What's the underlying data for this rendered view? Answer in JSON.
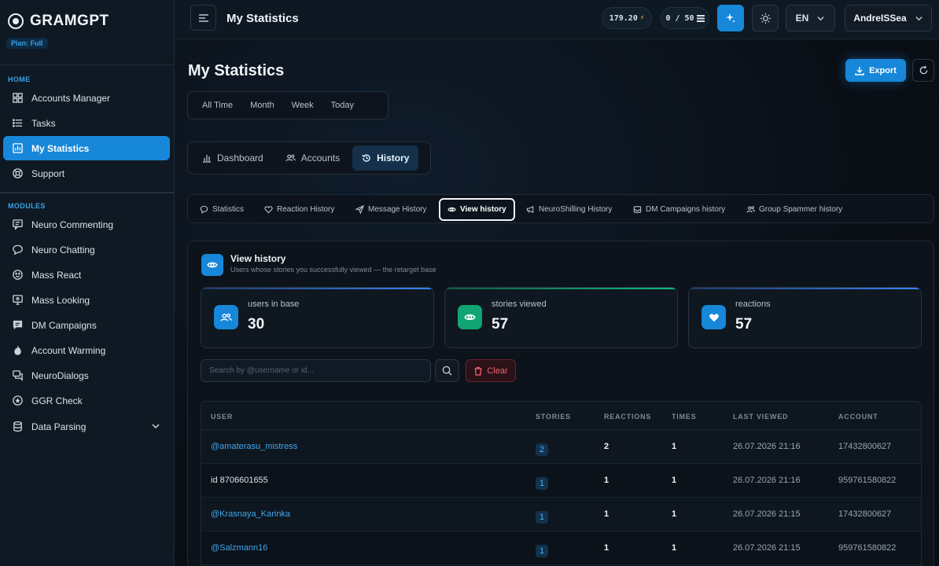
{
  "sidebar": {
    "brand": "GRAMGPT",
    "plan": "Plan: Full",
    "sections": {
      "home": "HOME",
      "modules": "MODULES"
    },
    "home_items": [
      {
        "label": "Accounts Manager",
        "icon": "grid-icon"
      },
      {
        "label": "Tasks",
        "icon": "list-icon"
      },
      {
        "label": "My Statistics",
        "icon": "chart-icon",
        "active": true
      },
      {
        "label": "Support",
        "icon": "lifebuoy-icon"
      }
    ],
    "module_items": [
      {
        "label": "Neuro Commenting",
        "icon": "comments-icon"
      },
      {
        "label": "Neuro Chatting",
        "icon": "chat-bubble-icon"
      },
      {
        "label": "Mass React",
        "icon": "smile-icon"
      },
      {
        "label": "Mass Looking",
        "icon": "monitor-eye-icon"
      },
      {
        "label": "DM Campaigns",
        "icon": "dm-icon"
      },
      {
        "label": "Account Warming",
        "icon": "flame-icon"
      },
      {
        "label": "NeuroDialogs",
        "icon": "dialogs-icon"
      },
      {
        "label": "GGR Check",
        "icon": "star-circle-icon"
      },
      {
        "label": "Data Parsing",
        "icon": "database-icon"
      }
    ]
  },
  "topbar": {
    "title": "My Statistics",
    "balance": "179.20",
    "slots": "0 / 50",
    "lang": "EN",
    "user": "AndreISSea"
  },
  "page": {
    "title": "My Statistics",
    "export_label": "Export",
    "ranges": [
      "All Time",
      "Month",
      "Week",
      "Today"
    ],
    "tabs": [
      {
        "label": "Dashboard"
      },
      {
        "label": "Accounts"
      },
      {
        "label": "History",
        "active": true
      }
    ],
    "subtabs": [
      {
        "label": "Statistics"
      },
      {
        "label": "Reaction History"
      },
      {
        "label": "Message History"
      },
      {
        "label": "View history",
        "active": true
      },
      {
        "label": "NeuroShilling History"
      },
      {
        "label": "DM Campaigns history"
      },
      {
        "label": "Group Spammer history"
      }
    ]
  },
  "panel": {
    "title": "View history",
    "subtitle": "Users whose stories you successfully viewed — the retarget base",
    "stats": [
      {
        "label": "users in base",
        "value": "30",
        "color": "#3b82f6"
      },
      {
        "label": "stories viewed",
        "value": "57",
        "color": "#10b981"
      },
      {
        "label": "reactions",
        "value": "57",
        "color": "#3b82f6"
      }
    ],
    "search_placeholder": "Search by @username or id...",
    "clear_label": "Clear"
  },
  "table": {
    "headers": {
      "user": "USER",
      "stories": "STORIES",
      "reactions": "REACTIONS",
      "times": "TIMES",
      "last": "LAST VIEWED",
      "account": "ACCOUNT"
    },
    "rows": [
      {
        "user": "@amaterasu_mistress",
        "link": true,
        "stories": "2",
        "reactions": "2",
        "times": "1",
        "last": "26.07.2026 21:16",
        "account": "17432800627"
      },
      {
        "user": "id 8706601655",
        "link": false,
        "stories": "1",
        "reactions": "1",
        "times": "1",
        "last": "26.07.2026 21:16",
        "account": "959761580822"
      },
      {
        "user": "@Krasnaya_Karinka",
        "link": true,
        "stories": "1",
        "reactions": "1",
        "times": "1",
        "last": "26.07.2026 21:15",
        "account": "17432800627"
      },
      {
        "user": "@Salzmann16",
        "link": true,
        "stories": "1",
        "reactions": "1",
        "times": "1",
        "last": "26.07.2026 21:15",
        "account": "959761580822"
      }
    ]
  }
}
